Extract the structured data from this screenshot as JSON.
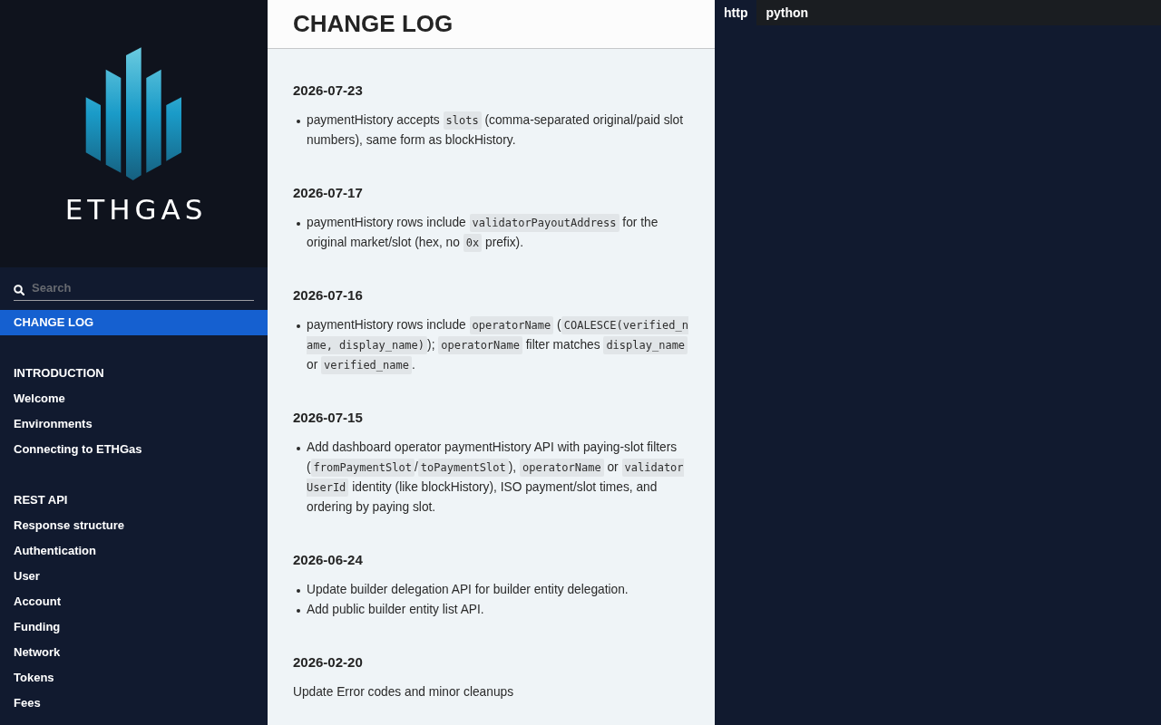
{
  "sidebar": {
    "logo": {
      "text": "ETHGAS"
    },
    "search": {
      "placeholder": "Search"
    },
    "sections": [
      {
        "items": [
          {
            "label": "CHANGE LOG",
            "selected": true
          }
        ]
      },
      {
        "heading": "INTRODUCTION",
        "items": [
          {
            "label": "Welcome",
            "selected": false
          },
          {
            "label": "Environments",
            "selected": false
          },
          {
            "label": "Connecting to ETHGas",
            "selected": false
          }
        ]
      },
      {
        "heading": "REST API",
        "items": [
          {
            "label": "Response structure",
            "selected": false
          },
          {
            "label": "Authentication",
            "selected": false
          },
          {
            "label": "User",
            "selected": false
          },
          {
            "label": "Account",
            "selected": false
          },
          {
            "label": "Funding",
            "selected": false
          },
          {
            "label": "Network",
            "selected": false
          },
          {
            "label": "Tokens",
            "selected": false
          },
          {
            "label": "Fees",
            "selected": false
          }
        ]
      }
    ]
  },
  "content": {
    "title": "CHANGE LOG",
    "entries": [
      {
        "date": "2026-07-23",
        "kind": "list",
        "items": [
          {
            "runs": [
              {
                "kind": "text",
                "text": "paymentHistory accepts "
              },
              {
                "kind": "code",
                "text": "slots"
              },
              {
                "kind": "text",
                "text": " (comma-separated original/paid slot numbers), same form as blockHistory."
              }
            ]
          }
        ]
      },
      {
        "date": "2026-07-17",
        "kind": "list",
        "items": [
          {
            "runs": [
              {
                "kind": "text",
                "text": "paymentHistory rows include "
              },
              {
                "kind": "code",
                "text": "validatorPayoutAddress"
              },
              {
                "kind": "text",
                "text": " for the original market/slot (hex, no "
              },
              {
                "kind": "code",
                "text": "0x"
              },
              {
                "kind": "text",
                "text": " prefix)."
              }
            ]
          }
        ]
      },
      {
        "date": "2026-07-16",
        "kind": "list",
        "items": [
          {
            "runs": [
              {
                "kind": "text",
                "text": "paymentHistory rows include "
              },
              {
                "kind": "code",
                "text": "operatorName"
              },
              {
                "kind": "text",
                "text": " ("
              },
              {
                "kind": "code",
                "text": "COALESCE(verified_name, display_name)"
              },
              {
                "kind": "text",
                "text": "); "
              },
              {
                "kind": "code",
                "text": "operatorName"
              },
              {
                "kind": "text",
                "text": " filter matches "
              },
              {
                "kind": "code",
                "text": "display_name"
              },
              {
                "kind": "text",
                "text": " or "
              },
              {
                "kind": "code",
                "text": "verified_name"
              },
              {
                "kind": "text",
                "text": "."
              }
            ]
          }
        ]
      },
      {
        "date": "2026-07-15",
        "kind": "list",
        "items": [
          {
            "runs": [
              {
                "kind": "text",
                "text": "Add dashboard operator paymentHistory API with paying-slot filters ("
              },
              {
                "kind": "code",
                "text": "fromPaymentSlot"
              },
              {
                "kind": "text",
                "text": "/"
              },
              {
                "kind": "code",
                "text": "toPaymentSlot"
              },
              {
                "kind": "text",
                "text": "), "
              },
              {
                "kind": "code",
                "text": "operatorName"
              },
              {
                "kind": "text",
                "text": " or "
              },
              {
                "kind": "code",
                "text": "validatorUserId"
              },
              {
                "kind": "text",
                "text": " identity (like blockHistory), ISO payment/slot times, and ordering by paying slot."
              }
            ]
          }
        ]
      },
      {
        "date": "2026-06-24",
        "kind": "list",
        "items": [
          {
            "runs": [
              {
                "kind": "text",
                "text": "Update builder delegation API for builder entity delegation."
              }
            ]
          },
          {
            "runs": [
              {
                "kind": "text",
                "text": "Add public builder entity list API."
              }
            ]
          }
        ]
      },
      {
        "date": "2026-02-20",
        "kind": "paragraph",
        "text": "Update Error codes and minor cleanups"
      }
    ]
  },
  "code_panel": {
    "tabs": [
      {
        "label": "http",
        "selected": true
      },
      {
        "label": "python",
        "selected": false
      }
    ]
  }
}
